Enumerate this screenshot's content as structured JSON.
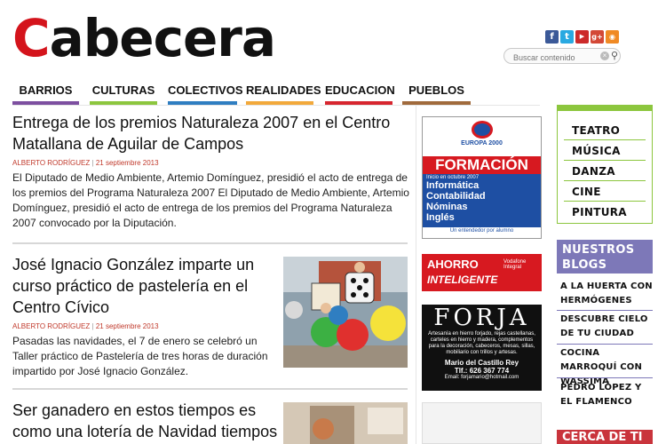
{
  "site": {
    "logo_first": "C",
    "logo_rest": "abecera"
  },
  "search": {
    "placeholder": "Buscar contenido"
  },
  "social": [
    {
      "name": "facebook",
      "glyph": "f",
      "color": "#3b5998"
    },
    {
      "name": "twitter",
      "glyph": "t",
      "color": "#29a9e1"
    },
    {
      "name": "youtube",
      "glyph": "▶",
      "color": "#cc2a2a"
    },
    {
      "name": "google-plus",
      "glyph": "g+",
      "color": "#d34836"
    },
    {
      "name": "rss",
      "glyph": "◉",
      "color": "#f08a24"
    }
  ],
  "nav": [
    {
      "label": "BARRIOS",
      "color": "#7d4fa0"
    },
    {
      "label": "CULTURAS",
      "color": "#8cc63e"
    },
    {
      "label": "COLECTIVOS",
      "color": "#2f7ec1"
    },
    {
      "label": "REALIDADES",
      "color": "#f2a93b"
    },
    {
      "label": "EDUCACION",
      "color": "#d7262f"
    },
    {
      "label": "PUEBLOS",
      "color": "#a06a3c"
    }
  ],
  "articles": [
    {
      "title": "Entrega de los premios Naturaleza 2007 en el Centro Matallana de Aguilar de Campos",
      "author": "ALBERTO RODRÍGUEZ",
      "date": "21 septiembre 2013",
      "excerpt": "El Diputado de Medio Ambiente, Artemio Domínguez, presidió el acto de entrega de los premios del Programa Naturaleza 2007 El Diputado de Medio Ambiente, Artemio Domínguez, presidió el acto de entrega de los premios del Programa Naturaleza 2007 convocado por la Diputación."
    },
    {
      "title": "José Ignacio González imparte un curso práctico de pastelería en el Centro Cívico",
      "author": "ALBERTO RODRÍGUEZ",
      "date": "21 septiembre 2013",
      "excerpt": "Pasadas las navidades, el 7 de enero se celebró un Taller práctico de Pastelería de tres horas de duración impartido por José Ignacio González."
    },
    {
      "title": "Ser ganadero en estos tiempos es como una lotería de Navidad tiempos"
    }
  ],
  "ads": {
    "europa": {
      "brand": "EUROPA 2000",
      "headline": "FORMACIÓN",
      "subline": "Inicio en octubre 2007",
      "courses": [
        "Informática",
        "Contabilidad",
        "Nóminas",
        "Inglés"
      ],
      "footer": "Un entendedor por alumno"
    },
    "vodafone": {
      "line1": "AHORRO",
      "line2": "INTELIGENTE",
      "side": "Vodafone Integral"
    },
    "forja": {
      "name": "FORJA",
      "desc": "Artesanía en hierro forjado, rejas castellanas, carteles en hierro y madera, complementos para la decoración, cabeceros, mesas, sillas, mobiliario con trillos y artesas.",
      "owner": "Mario del Castillo Rey",
      "phone": "Tlf.: 626 367 774",
      "email": "Email: forjamario@hotmail.com"
    }
  },
  "categories": [
    "TEATRO",
    "MÚSICA",
    "DANZA",
    "CINE",
    "PINTURA"
  ],
  "blogs": {
    "heading": "NUESTROS BLOGS",
    "items": [
      "A LA HUERTA CON HERMÓGENES",
      "DESCUBRE CIELO DE TU CIUDAD",
      "COCINA MARROQUÍ CON WASSIMA",
      "PEDRO LÓPEZ Y EL FLAMENCO"
    ]
  },
  "cerca": {
    "heading": "CERCA DE TI"
  }
}
